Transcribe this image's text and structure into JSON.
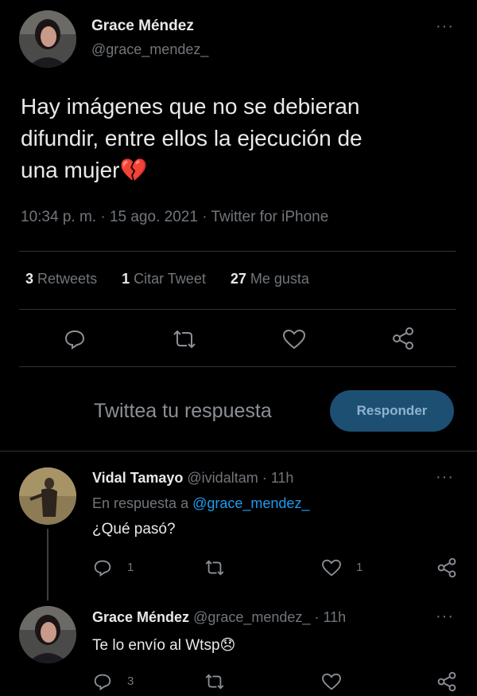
{
  "main_tweet": {
    "author_name": "Grace Méndez",
    "author_handle": "@grace_mendez_",
    "text_line1": "Hay imágenes que no se debieran",
    "text_line2": "difundir, entre ellos la ejecución de",
    "text_line3": "una mujer",
    "emoji": "💔",
    "time": "10:34 p. m.",
    "date": "15 ago. 2021",
    "source": "Twitter for iPhone",
    "sep": "·",
    "stats": {
      "retweets_count": "3",
      "retweets_label": "Retweets",
      "quotes_count": "1",
      "quotes_label": "Citar Tweet",
      "likes_count": "27",
      "likes_label": "Me gusta"
    },
    "more": "···"
  },
  "reply_box": {
    "placeholder": "Twittea tu respuesta",
    "button_label": "Responder"
  },
  "replies": [
    {
      "author_name": "Vidal Tamayo",
      "author_handle": "@ividaltam",
      "sep": "·",
      "time": "11h",
      "reply_prefix": "En respuesta a",
      "reply_to": "@grace_mendez_",
      "text": "¿Qué pasó?",
      "replies_count": "1",
      "retweets_count": "",
      "likes_count": "1",
      "more": "···"
    },
    {
      "author_name": "Grace Méndez",
      "author_handle": "@grace_mendez_",
      "sep": "·",
      "time": "11h",
      "text": "Te lo envío al Wtsp",
      "emoji": "😞",
      "replies_count": "3",
      "more": "···"
    }
  ],
  "colors": {
    "background": "#000000",
    "text": "#e7e9ea",
    "muted": "#71767b",
    "accent": "#1d9bf0",
    "button_bg": "#1d4f73",
    "heart_emoji": "#e0245e"
  }
}
